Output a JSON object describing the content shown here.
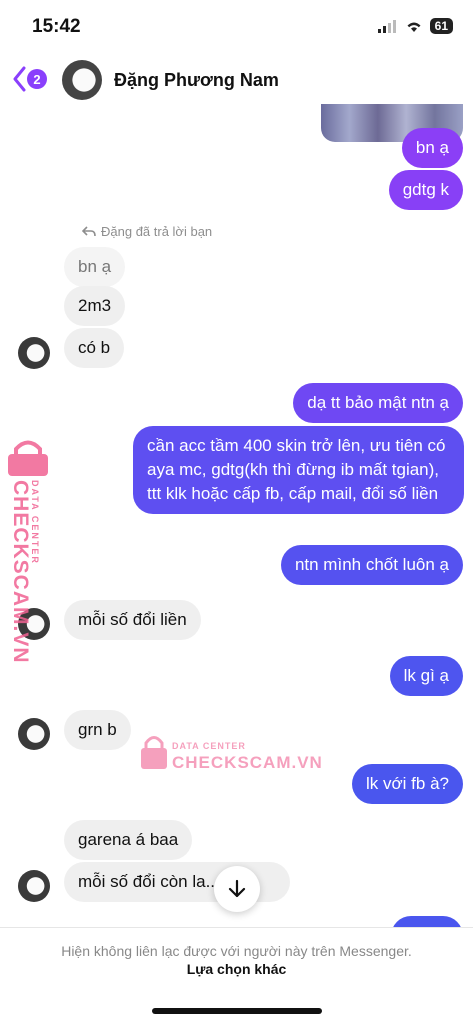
{
  "status_bar": {
    "time": "15:42",
    "battery": "61"
  },
  "header": {
    "back_count": "2",
    "contact_name": "Đặng Phương Nam"
  },
  "reply_note": "Đặng đã trả lời bạn",
  "messages": [
    {
      "id": "m1",
      "side": "out",
      "text": "bn ạ"
    },
    {
      "id": "m2",
      "side": "out",
      "text": "gdtg k"
    },
    {
      "id": "m3",
      "side": "in",
      "text": "bn ạ",
      "muted": true
    },
    {
      "id": "m4",
      "side": "in",
      "text": "2m3"
    },
    {
      "id": "m5",
      "side": "in",
      "text": "có b"
    },
    {
      "id": "m6",
      "side": "out",
      "text": "dạ tt bảo mật ntn ạ"
    },
    {
      "id": "m7",
      "side": "out",
      "text": "cần acc tầm 400 skin trở lên, ưu tiên có aya mc, gdtg(kh thì đừng ib mất tgian), ttt klk hoặc cấp fb, cấp mail, đổi số liền"
    },
    {
      "id": "m8",
      "side": "out",
      "text": "ntn mình chốt luôn ạ"
    },
    {
      "id": "m9",
      "side": "in",
      "text": "mỗi số đổi liền"
    },
    {
      "id": "m10",
      "side": "out",
      "text": "lk gì ạ"
    },
    {
      "id": "m11",
      "side": "in",
      "text": "grn b"
    },
    {
      "id": "m12",
      "side": "out",
      "text": "lk với fb à?"
    },
    {
      "id": "m13",
      "side": "in",
      "text": "garena á baa"
    },
    {
      "id": "m14",
      "side": "in",
      "text": "mỗi số đổi còn la...ng"
    }
  ],
  "watermark": {
    "top_text": "DATA CENTER",
    "brand": "CHECKSCAM.VN"
  },
  "footer": {
    "note": "Hiện không liên lạc được với người này trên Messenger.",
    "link": "Lựa chọn khác"
  },
  "colors": {
    "out_top": "#8b3ff6",
    "out_bottom": "#4a56ee",
    "incoming": "#efefef",
    "accent": "#8a3ffc",
    "watermark": "#f06292"
  },
  "icons": [
    "chevron-left-icon",
    "signal-icon",
    "wifi-icon",
    "battery-icon",
    "reply-arrow-icon",
    "arrow-down-icon",
    "lock-icon"
  ]
}
